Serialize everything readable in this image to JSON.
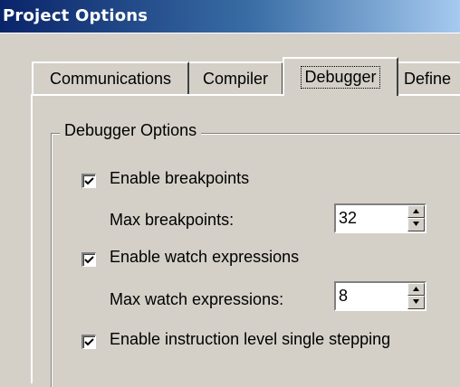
{
  "window": {
    "title": "Project Options"
  },
  "tabs": [
    {
      "label": "Communications"
    },
    {
      "label": "Compiler"
    },
    {
      "label": "Debugger",
      "selected": true
    },
    {
      "label": "Define"
    }
  ],
  "group": {
    "legend": "Debugger Options"
  },
  "options": {
    "enable_breakpoints": {
      "label": "Enable breakpoints",
      "checked": true
    },
    "max_breakpoints": {
      "label": "Max breakpoints:",
      "value": "32"
    },
    "enable_watch": {
      "label": "Enable watch expressions",
      "checked": true
    },
    "max_watch": {
      "label": "Max watch expressions:",
      "value": "8"
    },
    "enable_single_step": {
      "label": "Enable instruction level single stepping",
      "checked": true
    }
  },
  "colors": {
    "face": "#d4d0c8",
    "title_start": "#0a246a",
    "title_end": "#a6caf0"
  }
}
